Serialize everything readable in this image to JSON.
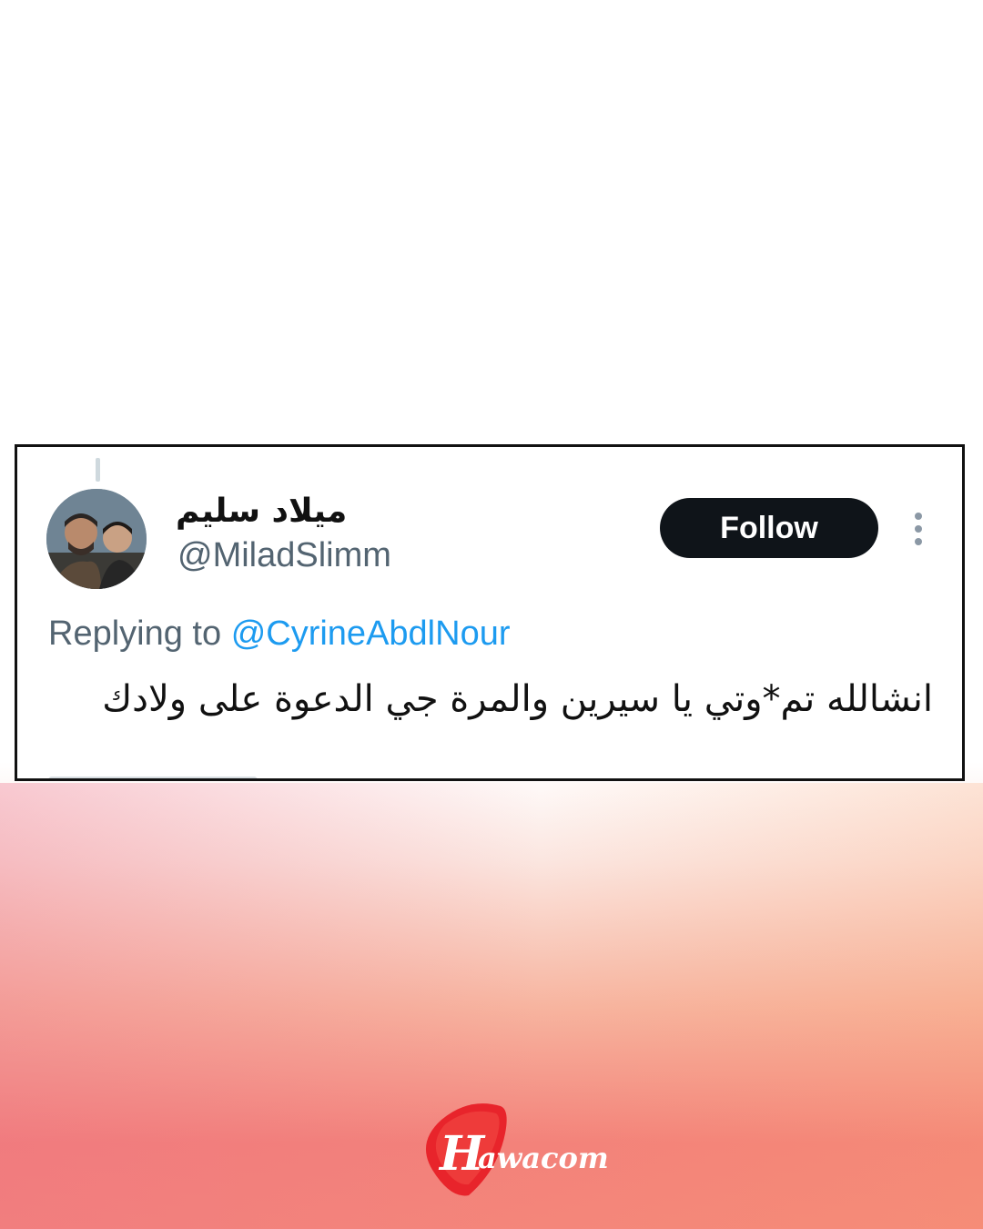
{
  "tweet": {
    "display_name": "ميلاد سليم",
    "handle": "@MiladSlimm",
    "follow_label": "Follow",
    "replying_prefix": "Replying to",
    "replying_to": "@CyrineAbdlNour",
    "text": "انشالله تم*وتي يا سيرين والمرة جي الدعوة على ولادك",
    "avatar_icon": "user-avatar-photo",
    "more_icon": "more-vertical-icon"
  },
  "watermark": {
    "brand": "Hawacom",
    "colors": {
      "red": "#e8242b",
      "white": "#ffffff"
    }
  },
  "colors": {
    "follow_bg": "#0f1419",
    "link": "#1d9bf0",
    "muted": "#536471"
  }
}
